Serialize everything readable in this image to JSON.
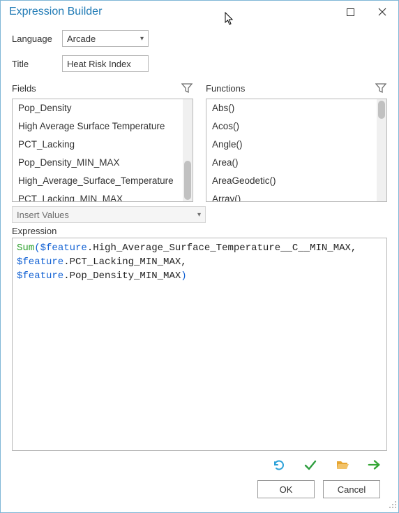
{
  "window": {
    "title": "Expression Builder"
  },
  "labels": {
    "language": "Language",
    "title": "Title",
    "fields": "Fields",
    "functions": "Functions",
    "insert_values": "Insert Values",
    "expression": "Expression"
  },
  "language": {
    "value": "Arcade"
  },
  "title_input": {
    "value": "Heat Risk Index"
  },
  "fields": {
    "items": [
      "Pop_Density",
      "High Average Surface Temperature",
      "PCT_Lacking",
      "Pop_Density_MIN_MAX",
      "High_Average_Surface_Temperature",
      "PCT_Lacking_MIN_MAX"
    ]
  },
  "functions": {
    "items": [
      "Abs()",
      "Acos()",
      "Angle()",
      "Area()",
      "AreaGeodetic()",
      "Array()"
    ]
  },
  "expression": {
    "tokens": [
      {
        "t": "fn",
        "v": "Sum"
      },
      {
        "t": "punc",
        "v": "("
      },
      {
        "t": "feat",
        "v": "$feature"
      },
      {
        "t": "field",
        "v": ".High_Average_Surface_Temperature__C__MIN_MAX"
      },
      {
        "t": "field",
        "v": ","
      },
      {
        "t": "nl",
        "v": ""
      },
      {
        "t": "feat",
        "v": "$feature"
      },
      {
        "t": "field",
        "v": ".PCT_Lacking_MIN_MAX"
      },
      {
        "t": "field",
        "v": ","
      },
      {
        "t": "nl",
        "v": ""
      },
      {
        "t": "feat",
        "v": "$feature"
      },
      {
        "t": "field",
        "v": ".Pop_Density_MIN_MAX"
      },
      {
        "t": "punc",
        "v": ")"
      }
    ]
  },
  "buttons": {
    "ok": "OK",
    "cancel": "Cancel"
  },
  "icons": {
    "filter": "filter",
    "undo": "undo",
    "validate": "validate",
    "open": "open-folder",
    "export": "export-arrow"
  },
  "colors": {
    "accent": "#1f7ab5",
    "undo": "#2aa0d8",
    "validate": "#2e9e3f",
    "folder": "#e6a531",
    "export": "#34a634"
  }
}
